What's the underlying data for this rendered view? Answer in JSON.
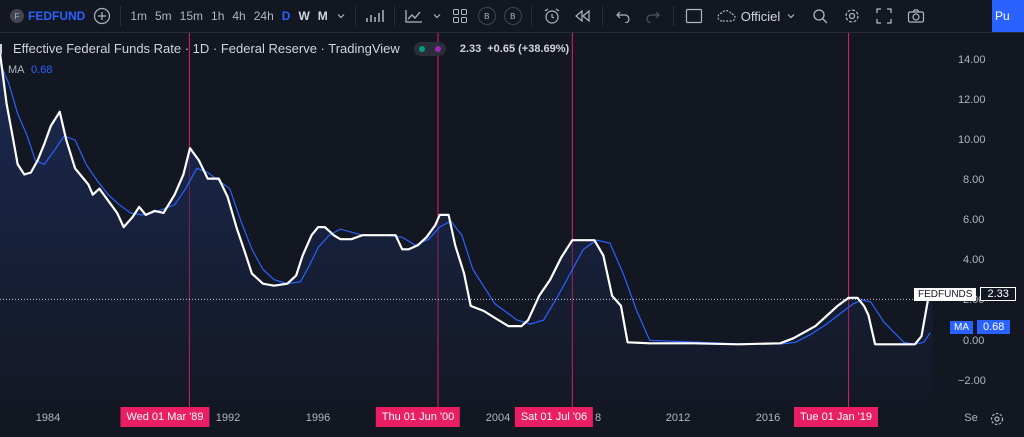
{
  "toolbar": {
    "symbol_badge": "F",
    "symbol": "FEDFUND",
    "intervals": [
      "1m",
      "5m",
      "15m",
      "1h",
      "4h",
      "24h",
      "D",
      "W",
      "M"
    ],
    "active_interval": "D",
    "b_label": "B",
    "chart_style": "Officiel",
    "publish_label": "Pu"
  },
  "legend": {
    "title": "Effective Federal Funds Rate · 1D · Federal Reserve · TradingView",
    "last": "2.33",
    "change": "+0.65 (+38.69%)",
    "ma_label": "MA",
    "ma_value": "0.68"
  },
  "colors": {
    "background": "#131722",
    "price_line": "#ffffff",
    "ma_line": "#2962ff",
    "marker": "#e91e63",
    "area_top": "#1c2b55"
  },
  "price_scale": {
    "ticks": [
      "14.00",
      "12.00",
      "10.00",
      "8.00",
      "6.00",
      "4.00",
      "2.00",
      "0.00",
      "−2.00"
    ],
    "symbol_tag": "FEDFUNDS",
    "last_value": "2.33",
    "ma_tag": "MA",
    "ma_value": "0.68"
  },
  "time_axis": {
    "ticks": [
      "1984",
      "1992",
      "1996",
      "2004",
      "8",
      "2012",
      "2016",
      "Se"
    ],
    "markers": [
      "Wed 01 Mar '89",
      "Thu 01 Jun '00",
      "Sat 01 Jul '06",
      "Tue 01 Jan '19"
    ]
  },
  "chart_data": {
    "type": "line",
    "title": "Effective Federal Funds Rate · 1D · Federal Reserve · TradingView",
    "ylim": [
      -3,
      15.5
    ],
    "xlim": [
      1980.6,
      2023.5
    ],
    "series": [
      {
        "name": "FEDFUNDS",
        "x": [
          1980.6,
          1980.9,
          1981.2,
          1981.4,
          1981.7,
          1982.0,
          1982.3,
          1982.6,
          1982.9,
          1983.3,
          1983.6,
          1984.0,
          1984.3,
          1984.6,
          1984.8,
          1985.1,
          1985.5,
          1985.9,
          1986.2,
          1986.6,
          1986.9,
          1987.2,
          1987.6,
          1988.0,
          1988.5,
          1988.9,
          1989.2,
          1989.6,
          1990.0,
          1990.5,
          1990.9,
          1991.3,
          1991.7,
          1992.0,
          1992.5,
          1993.0,
          1993.6,
          1994.0,
          1994.3,
          1994.7,
          1995.0,
          1995.3,
          1995.7,
          1996.0,
          1996.5,
          1997.0,
          1997.5,
          1998.0,
          1998.5,
          1998.8,
          1999.1,
          1999.5,
          1999.9,
          2000.3,
          2000.5,
          2000.9,
          2001.2,
          2001.6,
          2001.9,
          2002.5,
          2003.0,
          2003.6,
          2004.2,
          2004.5,
          2005.0,
          2005.5,
          2006.0,
          2006.5,
          2007.0,
          2007.5,
          2007.9,
          2008.3,
          2008.7,
          2009.0,
          2010.0,
          2012.0,
          2014.0,
          2015.9,
          2016.5,
          2017.0,
          2017.5,
          2018.0,
          2018.5,
          2019.0,
          2019.4,
          2019.7,
          2019.9,
          2020.2,
          2021.0,
          2022.0,
          2022.3,
          2022.6,
          2022.8
        ],
        "values": [
          14.5,
          12.0,
          10.2,
          9.0,
          8.5,
          8.6,
          9.2,
          10.0,
          10.9,
          11.6,
          10.2,
          8.8,
          8.4,
          8.0,
          7.5,
          7.8,
          7.2,
          6.6,
          5.9,
          6.4,
          6.9,
          6.5,
          6.7,
          6.6,
          7.5,
          8.5,
          9.8,
          9.2,
          8.3,
          8.3,
          7.4,
          5.9,
          4.6,
          3.6,
          3.1,
          3.0,
          3.1,
          3.5,
          4.5,
          5.5,
          5.9,
          5.9,
          5.5,
          5.3,
          5.3,
          5.5,
          5.5,
          5.5,
          5.5,
          4.8,
          4.8,
          5.0,
          5.4,
          6.0,
          6.5,
          6.5,
          5.0,
          3.6,
          2.0,
          1.75,
          1.4,
          1.0,
          1.0,
          1.3,
          2.5,
          3.3,
          4.4,
          5.25,
          5.25,
          5.25,
          4.5,
          2.5,
          2.0,
          0.2,
          0.15,
          0.15,
          0.1,
          0.15,
          0.4,
          0.7,
          1.0,
          1.5,
          2.0,
          2.4,
          2.4,
          2.0,
          1.55,
          0.1,
          0.1,
          0.1,
          0.5,
          2.33,
          2.33
        ]
      },
      {
        "name": "MA",
        "x": [
          1980.6,
          1981.0,
          1981.4,
          1981.8,
          1982.2,
          1982.6,
          1983.0,
          1983.5,
          1984.0,
          1984.5,
          1985.0,
          1985.5,
          1986.0,
          1986.5,
          1987.0,
          1987.5,
          1988.0,
          1988.5,
          1989.0,
          1989.5,
          1990.0,
          1990.5,
          1991.0,
          1991.5,
          1992.0,
          1992.5,
          1993.0,
          1993.6,
          1994.2,
          1994.6,
          1995.0,
          1995.5,
          1996.0,
          1997.0,
          1998.0,
          1998.8,
          1999.4,
          2000.0,
          2000.5,
          2001.0,
          2001.5,
          2002.0,
          2003.0,
          2004.0,
          2004.6,
          2005.2,
          2005.8,
          2006.4,
          2007.0,
          2007.6,
          2008.2,
          2008.8,
          2009.4,
          2010.0,
          2014.0,
          2016.0,
          2016.6,
          2017.3,
          2018.0,
          2018.6,
          2019.2,
          2019.6,
          2020.0,
          2020.6,
          2021.5,
          2022.0,
          2022.4,
          2022.7
        ],
        "values": [
          14.0,
          13.0,
          11.5,
          10.5,
          9.2,
          9.0,
          9.6,
          10.4,
          10.2,
          9.0,
          8.2,
          7.5,
          7.0,
          6.6,
          6.5,
          6.6,
          6.8,
          7.0,
          7.8,
          8.8,
          8.6,
          8.2,
          7.8,
          6.2,
          4.8,
          3.8,
          3.3,
          3.1,
          3.2,
          4.0,
          4.9,
          5.5,
          5.8,
          5.5,
          5.5,
          5.4,
          5.0,
          5.3,
          5.9,
          6.2,
          5.5,
          3.8,
          2.1,
          1.3,
          1.1,
          1.3,
          2.4,
          3.6,
          4.8,
          5.25,
          5.1,
          3.6,
          1.8,
          0.3,
          0.12,
          0.12,
          0.2,
          0.6,
          1.1,
          1.6,
          2.1,
          2.3,
          2.2,
          1.2,
          0.2,
          0.1,
          0.2,
          0.68
        ]
      }
    ],
    "markers_x": [
      1989.17,
      2000.42,
      2006.5,
      2019.0
    ]
  }
}
